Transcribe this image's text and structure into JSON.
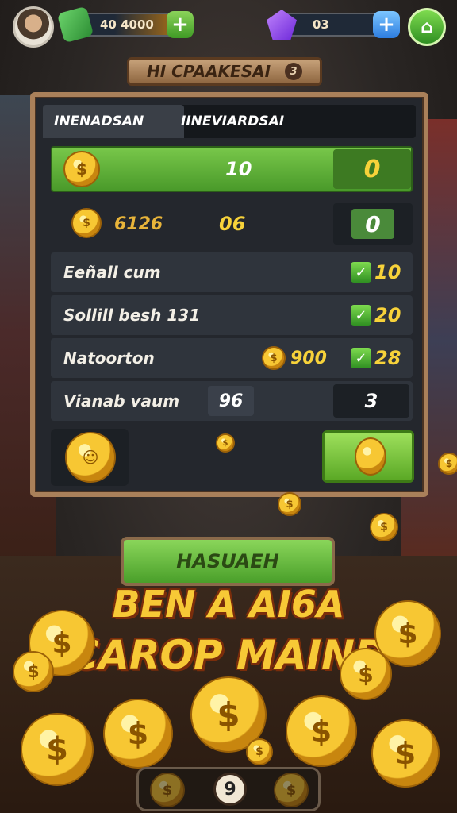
{
  "top_bar": {
    "cash_value": "40   4000",
    "gem_value": "03",
    "plus_label": "+",
    "shop_icon": "shop-icon"
  },
  "title": {
    "text": "HI  CPAAKESAI",
    "badge": "3"
  },
  "tabs": [
    {
      "label": "INENADSAN"
    },
    {
      "label": "IINEVIARDSAI"
    }
  ],
  "rows": {
    "green_value": "10",
    "green_reward": "0",
    "row2_count": "6126",
    "row2_value": "06",
    "row2_reward": "0",
    "row3_label": "Eeñall cum",
    "row3_reward": "10",
    "row4_label": "Sollill besh 131",
    "row4_reward": "20",
    "row5_label": "Natoorton",
    "row5_coins": "900",
    "row5_reward": "28",
    "row6_label": "Vianab vaum",
    "row6_value": "96",
    "row6_reward": "3"
  },
  "big_button": {
    "label": "HASUAEH"
  },
  "headline": {
    "line1": "BEN A AI6A",
    "line2": "CAROP  MAIND"
  },
  "bottom_bar": {
    "page": "9"
  },
  "colors": {
    "accent_green": "#78c74a",
    "coin_gold": "#f7c733",
    "panel_border": "#a9805a"
  }
}
